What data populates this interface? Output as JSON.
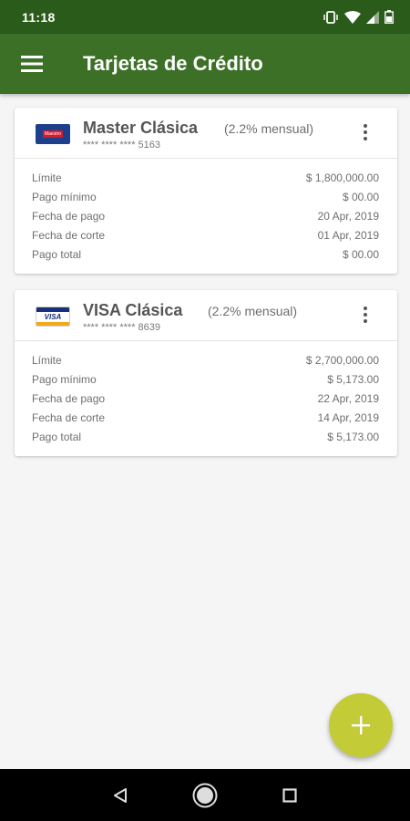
{
  "status_bar": {
    "time": "11:18",
    "icons": [
      "vibrate-icon",
      "wifi-icon",
      "signal-icon",
      "battery-icon"
    ]
  },
  "app_bar": {
    "title": "Tarjetas de Crédito",
    "menu_icon": "hamburger-menu-icon"
  },
  "cards": [
    {
      "name": "Master Clásica",
      "rate": "(2.2% mensual)",
      "number": "**** **** **** 5163",
      "logo": "mastercard-logo",
      "rows": [
        {
          "label": "Límite",
          "value": "$ 1,800,000.00"
        },
        {
          "label": "Pago mínimo",
          "value": "$ 00.00"
        },
        {
          "label": "Fecha de pago",
          "value": "20 Apr, 2019"
        },
        {
          "label": "Fecha de corte",
          "value": "01 Apr, 2019"
        },
        {
          "label": "Pago total",
          "value": "$ 00.00"
        }
      ]
    },
    {
      "name": "VISA Clásica",
      "rate": "(2.2% mensual)",
      "number": "**** **** **** 8639",
      "logo": "visa-logo",
      "logo_text": "VISA",
      "rows": [
        {
          "label": "Límite",
          "value": "$ 2,700,000.00"
        },
        {
          "label": "Pago mínimo",
          "value": "$ 5,173.00"
        },
        {
          "label": "Fecha de pago",
          "value": "22 Apr, 2019"
        },
        {
          "label": "Fecha de corte",
          "value": "14 Apr, 2019"
        },
        {
          "label": "Pago total",
          "value": "$ 5,173.00"
        }
      ]
    }
  ],
  "fab": {
    "icon": "plus-icon"
  },
  "nav_bar": {
    "buttons": [
      "back-icon",
      "home-icon",
      "recents-icon"
    ]
  },
  "colors": {
    "status_bar": "#2a5b1a",
    "app_bar": "#3c7027",
    "fab": "#c3cc36",
    "background": "#f5f5f5"
  }
}
